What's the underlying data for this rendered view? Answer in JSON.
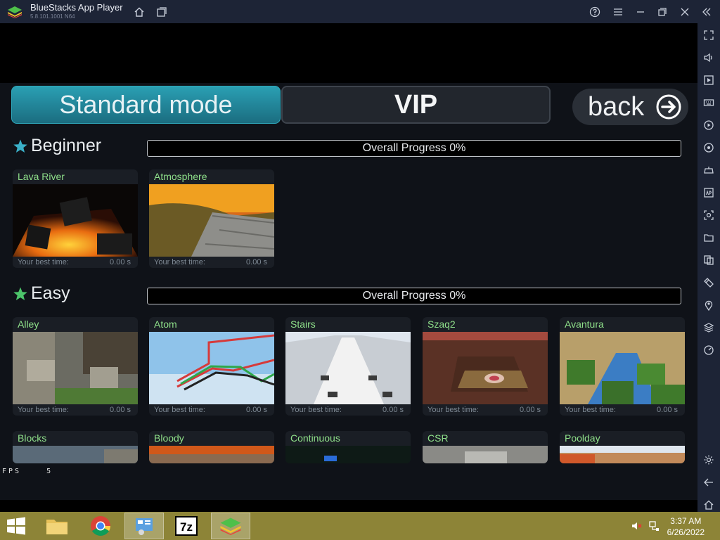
{
  "window": {
    "title": "BlueStacks App Player",
    "version": "5.8.101.1001 N64"
  },
  "game": {
    "tabs": {
      "standard": "Standard mode",
      "vip": "VIP"
    },
    "back_label": "back",
    "sections": [
      {
        "title": "Beginner",
        "progress_text": "Overall Progress 0%",
        "progress": 0,
        "levels": [
          {
            "name": "Lava River",
            "best_label": "Your best time:",
            "best_time": "0.00 s"
          },
          {
            "name": "Atmosphere",
            "best_label": "Your best time:",
            "best_time": "0.00 s"
          }
        ]
      },
      {
        "title": "Easy",
        "progress_text": "Overall Progress 0%",
        "progress": 0,
        "levels": [
          {
            "name": "Alley",
            "best_label": "Your best time:",
            "best_time": "0.00 s"
          },
          {
            "name": "Atom",
            "best_label": "Your best time:",
            "best_time": "0.00 s"
          },
          {
            "name": "Stairs",
            "best_label": "Your best time:",
            "best_time": "0.00 s"
          },
          {
            "name": "Szaq2",
            "best_label": "Your best time:",
            "best_time": "0.00 s"
          },
          {
            "name": "Avantura",
            "best_label": "Your best time:",
            "best_time": "0.00 s"
          }
        ]
      }
    ],
    "next_row": [
      {
        "name": "Blocks"
      },
      {
        "name": "Bloody"
      },
      {
        "name": "Continuous"
      },
      {
        "name": "CSR"
      },
      {
        "name": "Poolday"
      }
    ],
    "fps_label": "FPS",
    "fps_value": "5"
  },
  "taskbar": {
    "time": "3:37 AM",
    "date": "6/26/2022"
  }
}
